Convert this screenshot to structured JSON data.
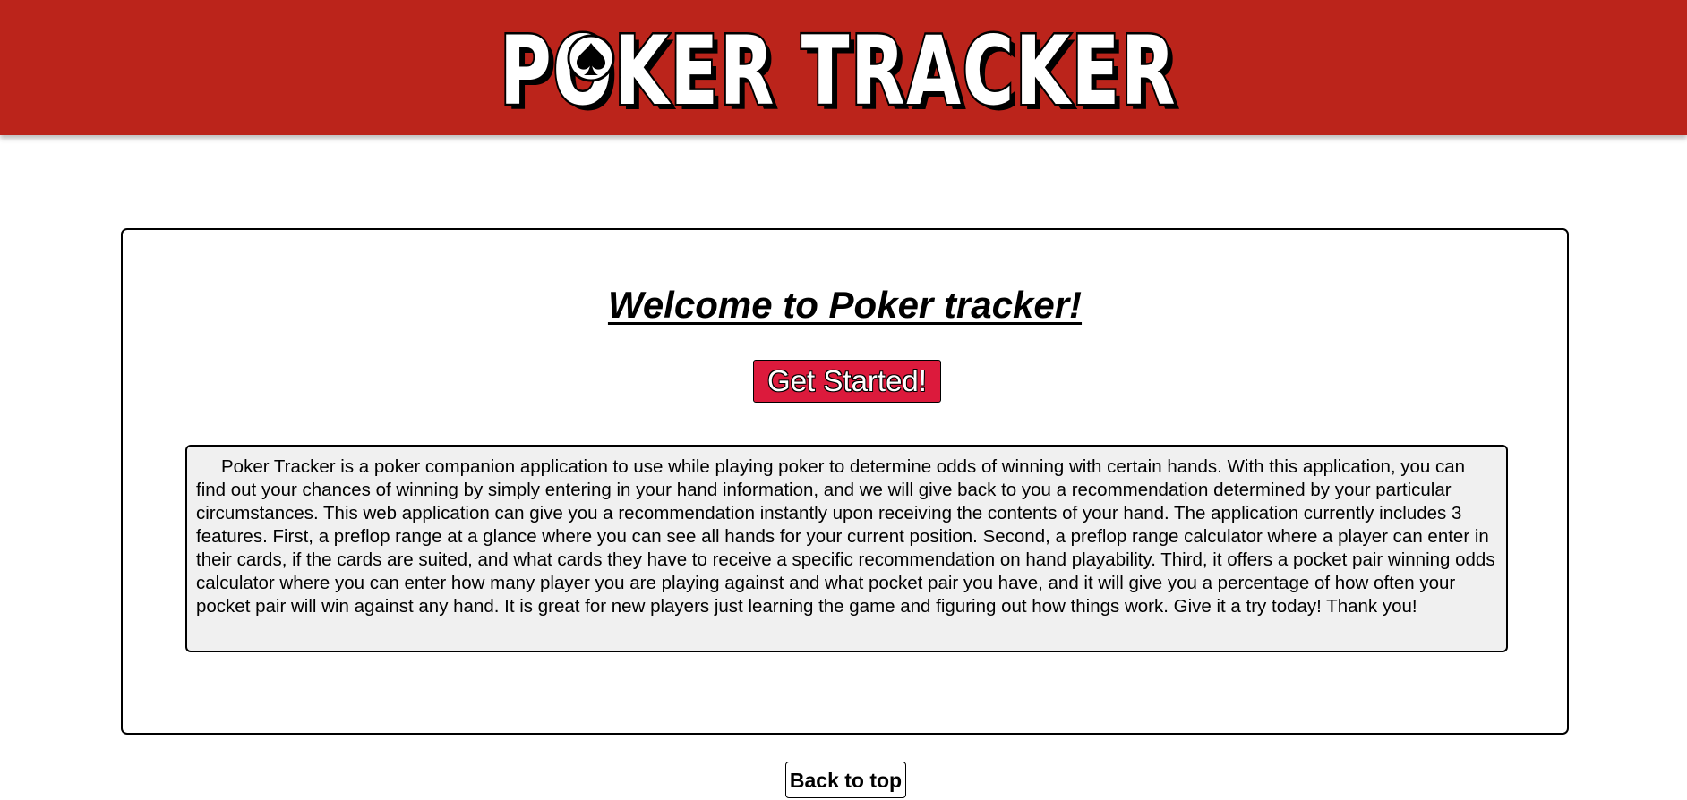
{
  "header": {
    "logo_text": "POKER TRACKER",
    "logo_icon": "spade-icon",
    "background_color": "#bb241b"
  },
  "main": {
    "welcome_title": "Welcome to Poker tracker!",
    "get_started_label": "Get Started!",
    "get_started_color": "#dc1a3c",
    "description": "Poker Tracker is a poker companion application to use while playing poker to determine odds of winning with certain hands. With this application, you can find out your chances of winning by simply entering in your hand information, and we will give back to you a recommendation determined by your particular circumstances. This web application can give you a recommendation instantly upon receiving the contents of your hand. The application currently includes 3 features. First, a preflop range at a glance where you can see all hands for your current position. Second, a preflop range calculator where a player can enter in their cards, if the cards are suited, and what cards they have to receive a specific recommendation on hand playability. Third, it offers a pocket pair winning odds calculator where you can enter how many player you are playing against and what pocket pair you have, and it will give you a percentage of how often your pocket pair will win against any hand. It is great for new players just learning the game and figuring out how things work. Give it a try today! Thank you!"
  },
  "footer": {
    "back_to_top_label": "Back to top"
  }
}
